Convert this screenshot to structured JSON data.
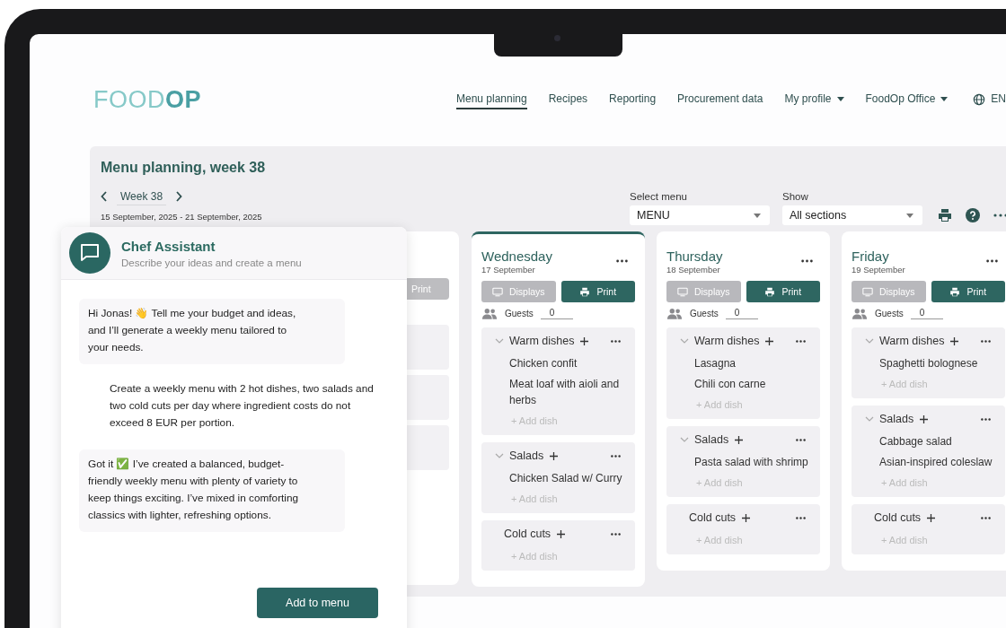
{
  "logo": {
    "parts": [
      "FOOD",
      "OP"
    ]
  },
  "nav": [
    {
      "label": "Menu planning",
      "kind": "link",
      "selected": true
    },
    {
      "label": "Recipes",
      "kind": "link",
      "selected": false
    },
    {
      "label": "Reporting",
      "kind": "link",
      "selected": false
    },
    {
      "label": "Procurement data",
      "kind": "link",
      "selected": false
    },
    {
      "label": "My profile",
      "kind": "dropdown",
      "selected": false
    },
    {
      "label": "FoodOp Office",
      "kind": "dropdown",
      "selected": false
    },
    {
      "label": "EN",
      "kind": "language",
      "selected": false
    }
  ],
  "planner": {
    "title": "Menu planning, week 38",
    "week": "Week 38",
    "date_range": "15 September, 2025 - 21 September, 2025",
    "selects": [
      {
        "label": "Select menu",
        "value": "MENU"
      },
      {
        "label": "Show",
        "value": "All sections"
      }
    ],
    "partial_day": {
      "print_label": "Print"
    },
    "days": [
      {
        "name": "Wednesday",
        "date": "17 September",
        "selected": true,
        "displays_label": "Displays",
        "print_label": "Print",
        "guests_label": "Guests",
        "guests": "0",
        "sections": [
          {
            "title": "Warm dishes",
            "expandable": true,
            "dishes": [
              "Chicken confit",
              "Meat loaf with aioli and herbs"
            ],
            "add_label": "+ Add dish"
          },
          {
            "title": "Salads",
            "expandable": true,
            "dishes": [
              "Chicken Salad w/ Curry"
            ],
            "add_label": "+ Add dish"
          },
          {
            "title": "Cold cuts",
            "expandable": false,
            "add_label": "+ Add dish"
          }
        ]
      },
      {
        "name": "Thursday",
        "date": "18 September",
        "selected": false,
        "displays_label": "Displays",
        "print_label": "Print",
        "guests_label": "Guests",
        "guests": "0",
        "sections": [
          {
            "title": "Warm dishes",
            "expandable": true,
            "dishes": [
              "Lasagna",
              "Chili con carne"
            ],
            "add_label": "+ Add dish"
          },
          {
            "title": "Salads",
            "expandable": true,
            "dishes": [
              "Pasta salad with shrimp"
            ],
            "add_label": "+ Add dish"
          },
          {
            "title": "Cold cuts",
            "expandable": false,
            "add_label": "+ Add dish"
          }
        ]
      },
      {
        "name": "Friday",
        "date": "19 September",
        "selected": false,
        "displays_label": "Displays",
        "print_label": "Print",
        "guests_label": "Guests",
        "guests": "0",
        "sections": [
          {
            "title": "Warm dishes",
            "expandable": true,
            "dishes": [
              "Spaghetti bolognese"
            ],
            "add_label": "+ Add dish"
          },
          {
            "title": "Salads",
            "expandable": true,
            "dishes": [
              "Cabbage salad",
              "Asian-inspired coleslaw"
            ],
            "add_label": "+ Add dish"
          },
          {
            "title": "Cold cuts",
            "expandable": false,
            "add_label": "+ Add dish"
          }
        ]
      }
    ]
  },
  "chat": {
    "title": "Chef Assistant",
    "subtitle": "Describe your ideas and create a menu",
    "messages": [
      {
        "kind": "assistant",
        "text": "Hi Jonas! 👋 Tell me your budget and ideas, and I’ll generate a weekly menu tailored to your needs."
      },
      {
        "kind": "user",
        "text": "Create a weekly menu with 2 hot dishes, two salads and two cold cuts per day where ingredient costs do not exceed 8 EUR per portion."
      },
      {
        "kind": "assistant",
        "text": "Got it ✅ I’ve created a balanced, budget-friendly weekly menu with plenty of variety to keep things exciting. I’ve mixed in comforting classics with lighter, refreshing options."
      }
    ],
    "button": "Add to menu"
  }
}
